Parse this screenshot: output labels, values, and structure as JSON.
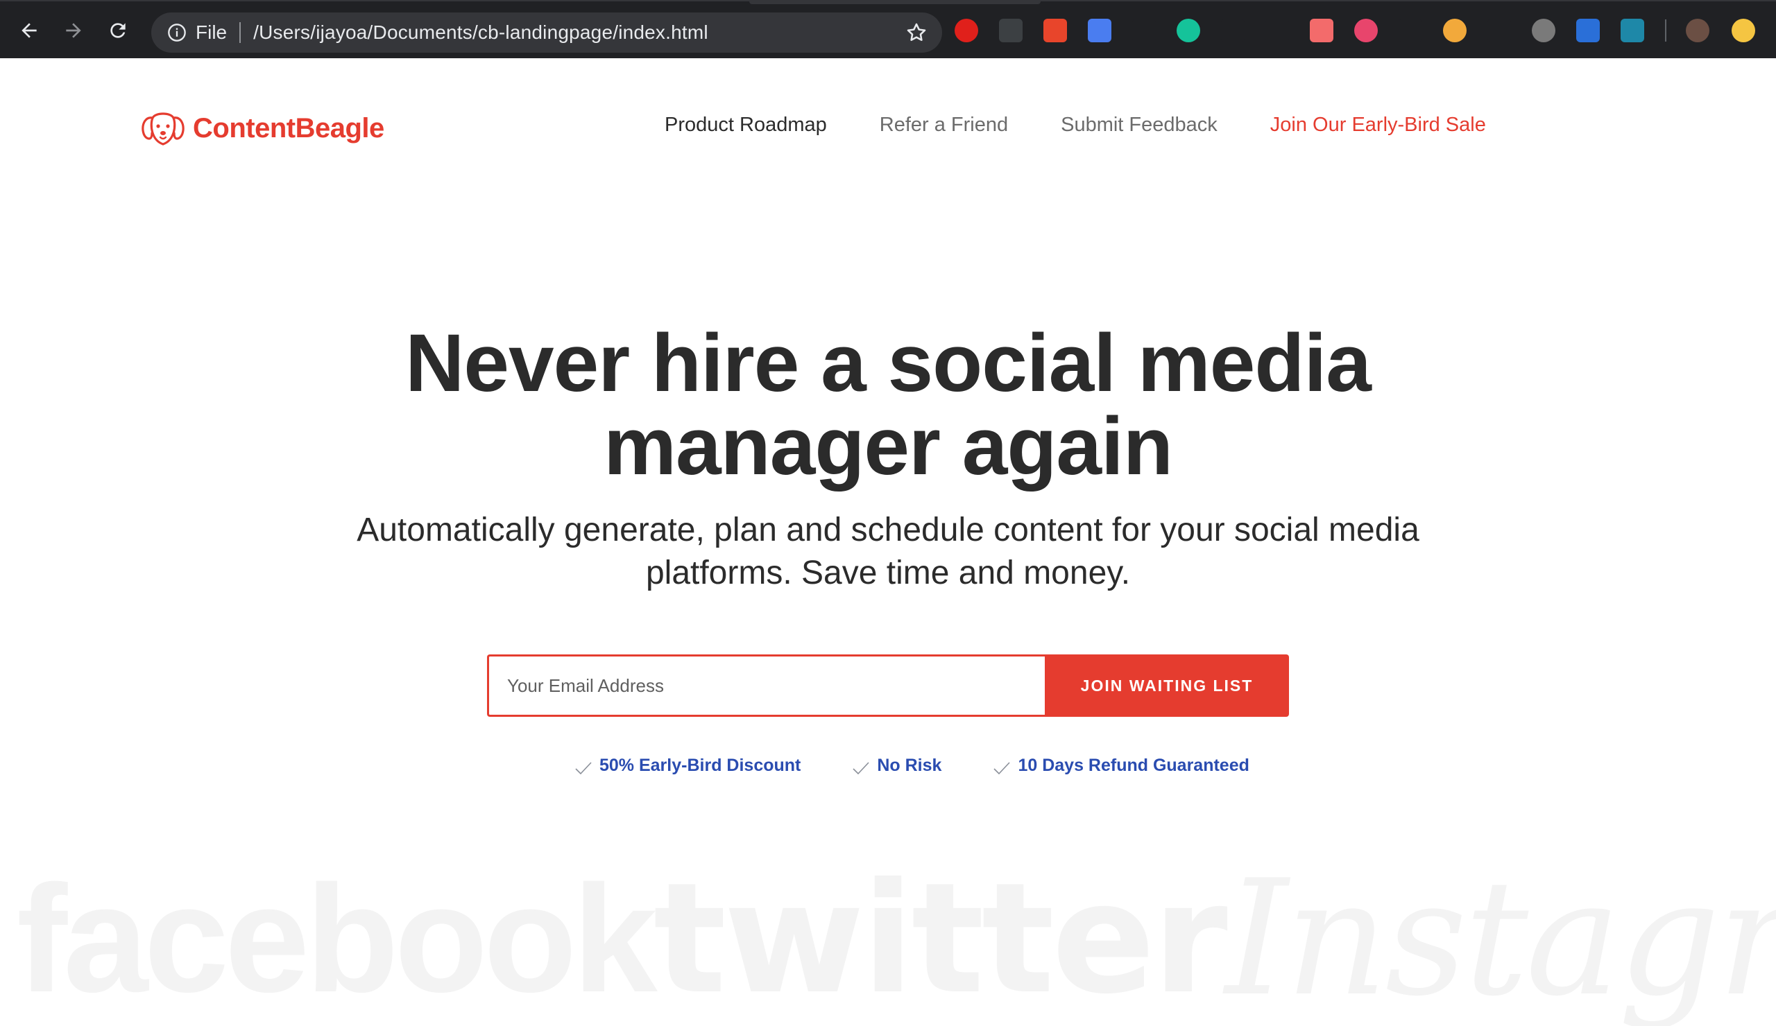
{
  "browser": {
    "scheme_label": "File",
    "url": "/Users/ijayoa/Documents/cb-landingpage/index.html",
    "extensions": [
      {
        "icon": "stop-hand-icon",
        "color": "#e0201b"
      },
      {
        "icon": "eyedropper-icon",
        "color": "#3c4043"
      },
      {
        "icon": "xa-translate-icon",
        "color": "#e8452b"
      },
      {
        "icon": "google-translate-icon",
        "color": "#4a7df0"
      },
      {
        "icon": "bird-icon",
        "color": "#202124"
      },
      {
        "icon": "grammarly-icon",
        "color": "#15c39a"
      },
      {
        "icon": "bus-icon",
        "color": "#202124"
      },
      {
        "icon": "puzzle-arrow-icon",
        "color": "#202124"
      },
      {
        "icon": "video-record-icon",
        "color": "#f36b6b"
      },
      {
        "icon": "t-circle-icon",
        "color": "#e8456c"
      },
      {
        "icon": "wj-icon",
        "color": "#202124"
      },
      {
        "icon": "gradient-circle-icon",
        "color": "#f2a93b"
      },
      {
        "icon": "react-atom-icon",
        "color": "#202124"
      },
      {
        "icon": "grey-circle-icon",
        "color": "#7a7a7a"
      },
      {
        "icon": "s-box-icon",
        "color": "#2a6fd8"
      },
      {
        "icon": "shield-cross-icon",
        "color": "#1e88a8"
      }
    ]
  },
  "brand": {
    "name": "ContentBeagle",
    "accent": "#e53c2f",
    "link_blue": "#2a4cb0"
  },
  "nav": {
    "items": [
      "Product Roadmap",
      "Refer a Friend",
      "Submit Feedback"
    ],
    "cta": "Join Our Early-Bird Sale"
  },
  "hero": {
    "title_line1": "Never hire a social media",
    "title_line2": "manager again",
    "subtitle_line1": "Automatically generate, plan and schedule content for your social media",
    "subtitle_line2": "platforms. Save time and money."
  },
  "signup": {
    "email_placeholder": "Your Email Address",
    "button_label": "JOIN WAITING LIST"
  },
  "perks": [
    "50% Early-Bird Discount",
    "No Risk",
    "10 Days Refund Guaranteed"
  ],
  "watermark": [
    "facebook",
    "twitter",
    "Instagram"
  ]
}
